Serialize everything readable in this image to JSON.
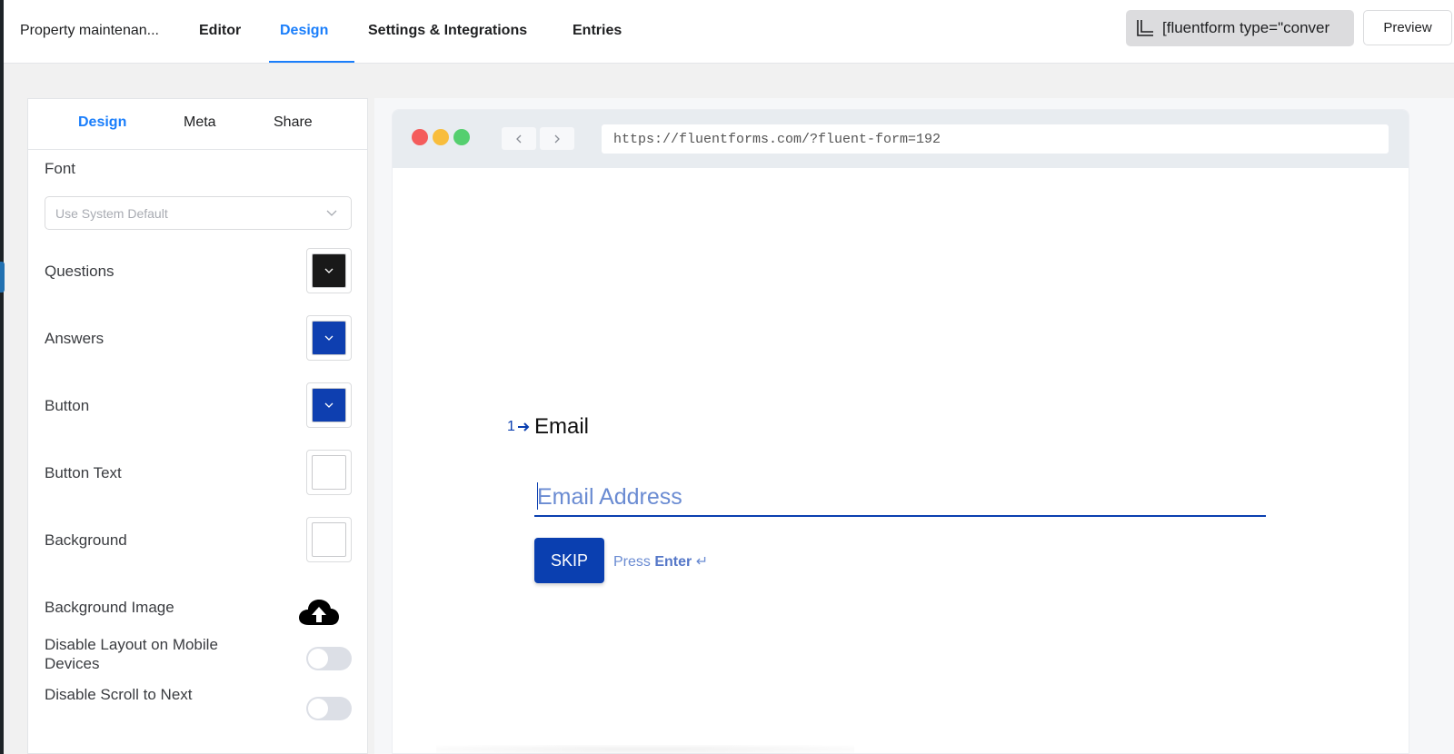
{
  "topbar": {
    "form_name": "Property maintenan...",
    "tabs": [
      {
        "label": "Editor",
        "active": false
      },
      {
        "label": "Design",
        "active": true
      },
      {
        "label": "Settings & Integrations",
        "active": false
      },
      {
        "label": "Entries",
        "active": false
      }
    ],
    "shortcode": "[fluentform type=\"conver",
    "preview_label": "Preview"
  },
  "panel": {
    "tabs": [
      {
        "label": "Design",
        "active": true
      },
      {
        "label": "Meta",
        "active": false
      },
      {
        "label": "Share",
        "active": false
      }
    ],
    "font_label": "Font",
    "font_placeholder": "Use System Default",
    "colors": [
      {
        "label": "Questions",
        "value": "#191919"
      },
      {
        "label": "Answers",
        "value": "#0e3fb0"
      },
      {
        "label": "Button",
        "value": "#0e3fb0"
      },
      {
        "label": "Button Text",
        "value": "#ffffff"
      },
      {
        "label": "Background",
        "value": "#ffffff"
      }
    ],
    "background_image_label": "Background Image",
    "disable_layout_label": "Disable Layout on Mobile Devices",
    "disable_layout_enabled": false,
    "disable_scroll_label": "Disable Scroll to Next",
    "disable_scroll_enabled": false
  },
  "browser": {
    "url": "https://fluentforms.com/?fluent-form=192"
  },
  "form": {
    "question_number": "1",
    "question_title": "Email",
    "input_placeholder": "Email Address",
    "skip_label": "SKIP",
    "press_label": "Press",
    "enter_label": "Enter",
    "enter_symbol": "↵"
  },
  "colors": {
    "accent": "#1a7efb",
    "form_primary": "#0a3fb0"
  }
}
